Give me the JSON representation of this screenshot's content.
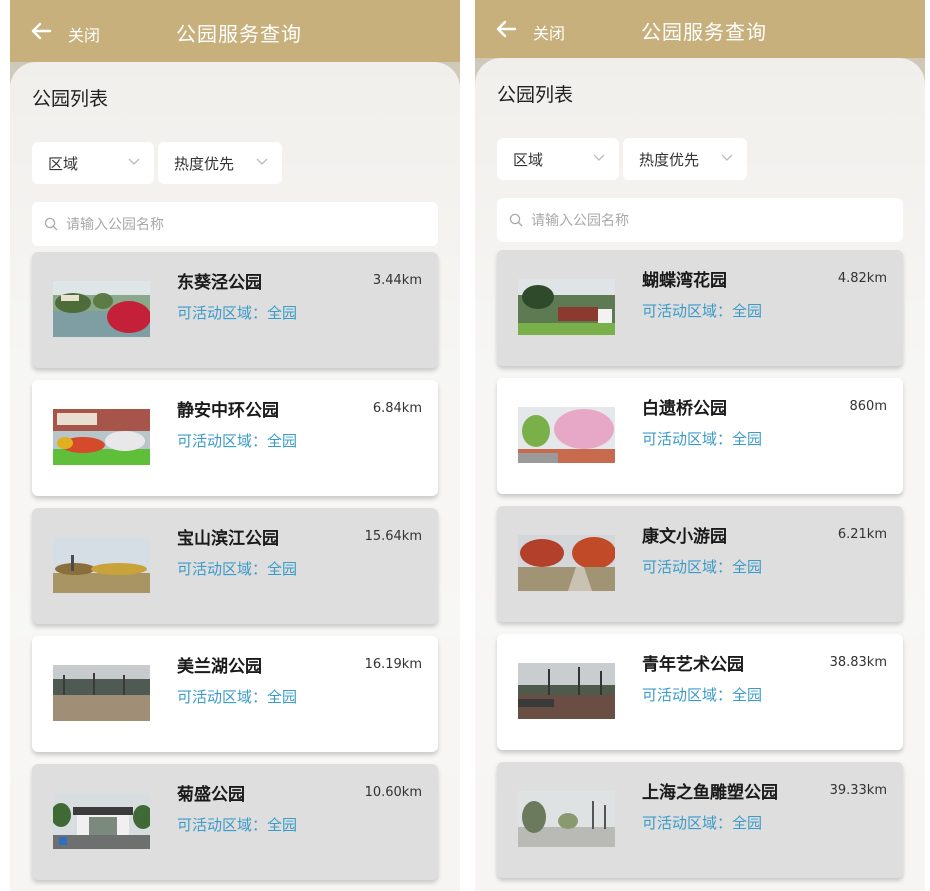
{
  "header": {
    "back_label": "关闭",
    "title": "公园服务查询"
  },
  "section_title": "公园列表",
  "filters": {
    "region_label": "区域",
    "sort_label": "热度优先"
  },
  "search": {
    "placeholder": "请输入公园名称"
  },
  "area_prefix": "可活动区域：",
  "screens": [
    {
      "parks": [
        {
          "name": "东葵泾公园",
          "distance": "3.44km",
          "area": "可活动区域：全园",
          "thumb": "pond-red-tree"
        },
        {
          "name": "静安中环公园",
          "distance": "6.84km",
          "area": "可活动区域：全园",
          "thumb": "flower-bed-building"
        },
        {
          "name": "宝山滨江公园",
          "distance": "15.64km",
          "area": "可活动区域：全园",
          "thumb": "lawn-autumn"
        },
        {
          "name": "美兰湖公园",
          "distance": "16.19km",
          "area": "可活动区域：全园",
          "thumb": "winter-grove"
        },
        {
          "name": "菊盛公园",
          "distance": "10.60km",
          "area": "可活动区域：全园",
          "thumb": "park-gate"
        }
      ]
    },
    {
      "parks": [
        {
          "name": "蝴蝶湾花园",
          "distance": "4.82km",
          "area": "可活动区域：全园",
          "thumb": "garden-sign"
        },
        {
          "name": "白遗桥公园",
          "distance": "860m",
          "area": "可活动区域：全园",
          "thumb": "cherry-blossom"
        },
        {
          "name": "康文小游园",
          "distance": "6.21km",
          "area": "可活动区域：全园",
          "thumb": "red-leaves-path"
        },
        {
          "name": "青年艺术公园",
          "distance": "38.83km",
          "area": "可活动区域：全园",
          "thumb": "plaza-trees"
        },
        {
          "name": "上海之鱼雕塑公园",
          "distance": "39.33km",
          "area": "可活动区域：全园",
          "thumb": "sculpture-walk"
        }
      ]
    }
  ],
  "colors": {
    "header_bg": "#c7b07c",
    "area_text": "#3a9bc8",
    "card_gray": "#dedede",
    "card_white": "#ffffff"
  }
}
